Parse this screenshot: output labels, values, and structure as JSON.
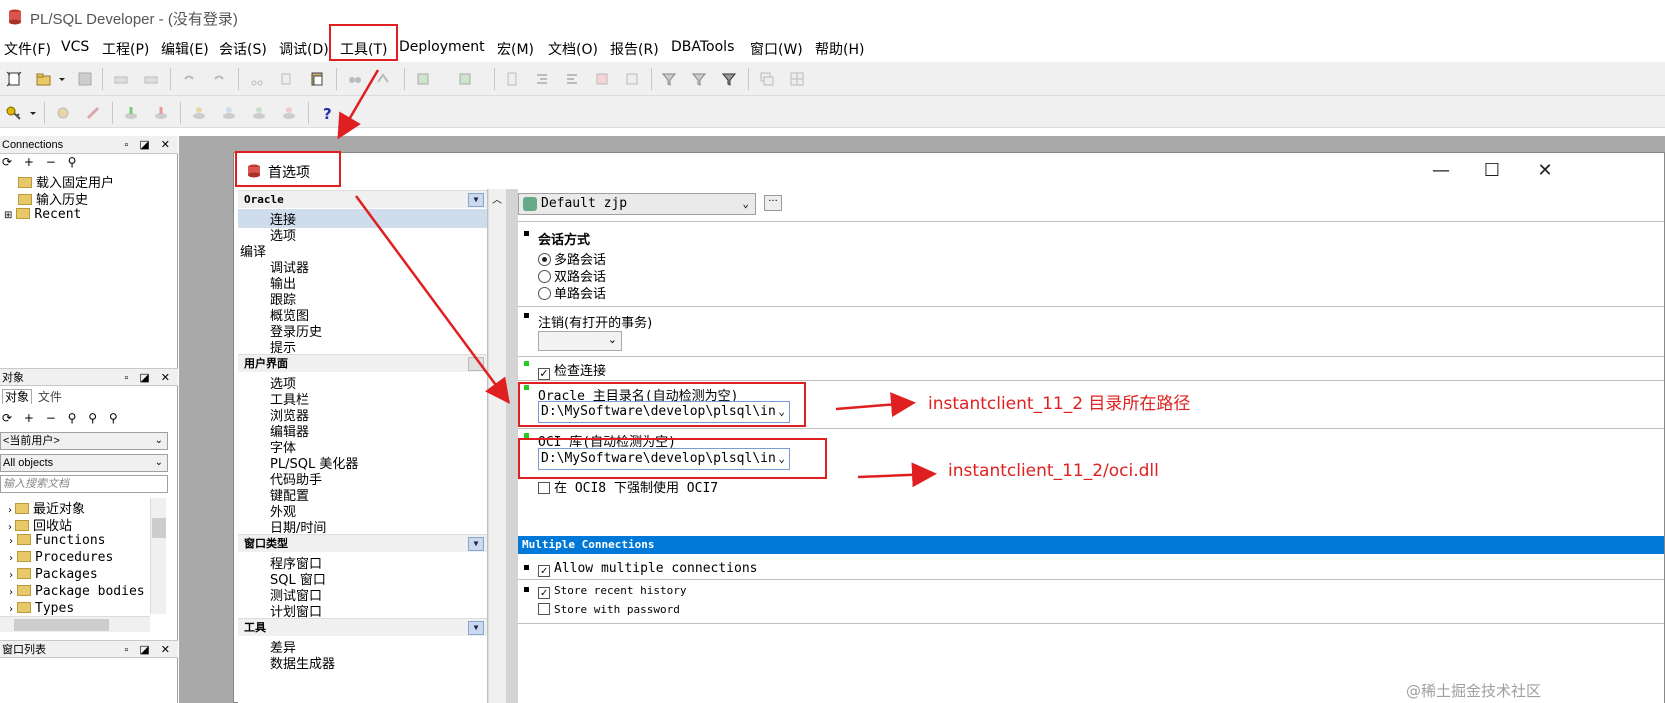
{
  "app": {
    "title": "PL/SQL Developer - (没有登录)"
  },
  "menubar": {
    "items": [
      "文件(F)",
      "VCS",
      "工程(P)",
      "编辑(E)",
      "会话(S)",
      "调试(D)",
      "工具(T)",
      "Deployment",
      "宏(M)",
      "文档(O)",
      "报告(R)",
      "DBATools",
      "窗口(W)",
      "帮助(H)"
    ]
  },
  "left_panel": {
    "connections": {
      "header": "Connections",
      "items": [
        "载入固定用户",
        "输入历史",
        "Recent"
      ]
    },
    "objects": {
      "header": "对象",
      "tabs": [
        "对象",
        "文件"
      ],
      "user_combo": "<当前用户>",
      "filter_combo": "All objects",
      "search_placeholder": "输入搜索文档",
      "items": [
        "最近对象",
        "回收站",
        "Functions",
        "Procedures",
        "Packages",
        "Package bodies",
        "Types"
      ]
    },
    "window_list": {
      "header": "窗口列表"
    }
  },
  "dialog": {
    "title": "首选项",
    "nav": {
      "sections": [
        {
          "title": "Oracle",
          "items": [
            "连接",
            "选项"
          ]
        },
        {
          "title": "",
          "items": [
            "编译",
            "调试器",
            "输出",
            "跟踪",
            "概览图",
            "登录历史",
            "提示"
          ]
        },
        {
          "title": "用户界面",
          "items": [
            "选项",
            "工具栏",
            "浏览器",
            "编辑器",
            "字体",
            "PL/SQL 美化器",
            "代码助手",
            "键配置",
            "外观",
            "日期/时间"
          ]
        },
        {
          "title": "窗口类型",
          "items": [
            "程序窗口",
            "SQL 窗口",
            "测试窗口",
            "计划窗口"
          ]
        },
        {
          "title": "工具",
          "items": [
            "差异",
            "数据生成器"
          ]
        }
      ],
      "selected": "连接"
    },
    "content": {
      "preference_set": "Default zjp",
      "session_mode": {
        "label": "会话方式",
        "options": [
          "多路会话",
          "双路会话",
          "单路会话"
        ],
        "selected": "多路会话"
      },
      "logoff_label": "注销(有打开的事务)",
      "logoff_value": "",
      "check_connection_label": "检查连接",
      "check_connection": true,
      "oracle_home_label": "Oracle 主目录名(自动检测为空)",
      "oracle_home_value": "D:\\MySoftware\\develop\\plsql\\in",
      "oci_label": "OCI 库(自动检测为空)",
      "oci_value": "D:\\MySoftware\\develop\\plsql\\in",
      "force_oci7_label": "在 OCI8 下强制使用 OCI7",
      "force_oci7": false,
      "multiple_connections_header": "Multiple Connections",
      "allow_multiple_label": "Allow multiple connections",
      "allow_multiple": true,
      "store_history_label": "Store recent history",
      "store_history": true,
      "store_password_label": "Store with password",
      "store_password": false
    }
  },
  "annotations": {
    "oracle_home_note": "instantclient_11_2 目录所在路径",
    "oci_note": "instantclient_11_2/oci.dll"
  },
  "watermark": "@稀土掘金技术社区",
  "colors": {
    "annotation_red": "#e02020",
    "band_blue": "#0078d7",
    "mdi_gray": "#a9a9a9"
  }
}
